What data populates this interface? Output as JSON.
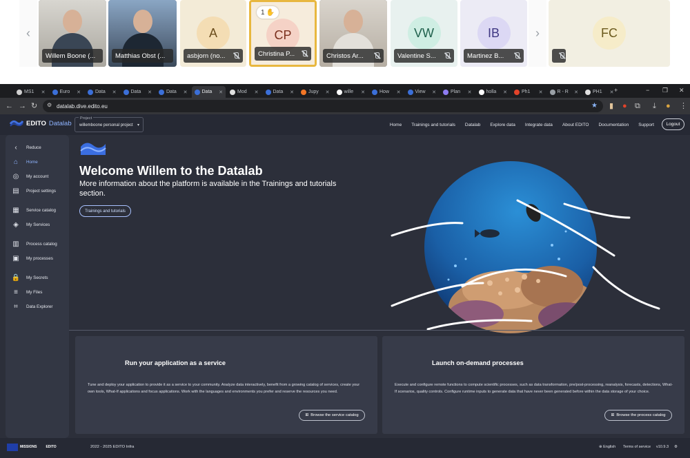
{
  "meeting": {
    "participants": [
      {
        "initials": "",
        "name": "Willem Boone (...",
        "type": "video",
        "muted": false
      },
      {
        "initials": "",
        "name": "Matthias Obst (...",
        "type": "video",
        "muted": false
      },
      {
        "initials": "A",
        "name": "asbjorn (no...",
        "type": "avatar",
        "muted": true,
        "bg": "#f3ebd7",
        "circle": "#f4ddb4",
        "fg": "#6b4d1d"
      },
      {
        "initials": "CP",
        "name": "Christina P...",
        "type": "avatar",
        "muted": true,
        "bg": "#f6ecdc",
        "circle": "#f5d2c6",
        "fg": "#7a2f1d",
        "hand": "1"
      },
      {
        "initials": "",
        "name": "Christos Ar...",
        "type": "video",
        "muted": true
      },
      {
        "initials": "VW",
        "name": "Valentine S...",
        "type": "avatar",
        "muted": true,
        "bg": "#e8f1ef",
        "circle": "#cfeee3",
        "fg": "#20614d"
      },
      {
        "initials": "IB",
        "name": "Martinez B...",
        "type": "avatar",
        "muted": true,
        "bg": "#ecebf5",
        "circle": "#dcd8f4",
        "fg": "#3f3783"
      },
      {
        "initials": "FC",
        "name": "",
        "type": "avatar",
        "muted": true,
        "bg": "#f2efe2",
        "circle": "#f6ecc9",
        "fg": "#6b5a1d"
      }
    ],
    "prev_icon": "chevron-left-icon",
    "next_icon": "chevron-right-icon"
  },
  "browser": {
    "tabs": [
      {
        "label": "MS1",
        "fav": "#d0d0d0"
      },
      {
        "label": "Euro",
        "fav": "#3b6fd8"
      },
      {
        "label": "Data",
        "fav": "#3b6fd8"
      },
      {
        "label": "Data",
        "fav": "#3b6fd8"
      },
      {
        "label": "Data",
        "fav": "#3b6fd8"
      },
      {
        "label": "Data",
        "fav": "#3b6fd8",
        "active": true
      },
      {
        "label": "Mod",
        "fav": "#e0e0e0"
      },
      {
        "label": "Data",
        "fav": "#3b6fd8"
      },
      {
        "label": "Jupy",
        "fav": "#f37626"
      },
      {
        "label": "wille",
        "fav": "#ffffff"
      },
      {
        "label": "How",
        "fav": "#3b6fd8"
      },
      {
        "label": "View",
        "fav": "#3b6fd8"
      },
      {
        "label": "Plan",
        "fav": "#8e7cf2"
      },
      {
        "label": "holla",
        "fav": "#ffffff"
      },
      {
        "label": "Ph1",
        "fav": "#e2432a"
      },
      {
        "label": "R - R",
        "fav": "#9aa0a6"
      },
      {
        "label": "PH1",
        "fav": "#e0e0e0"
      }
    ],
    "url": "datalab.dive.edito.eu",
    "window_controls": [
      "−",
      "❐",
      "✕"
    ]
  },
  "app": {
    "brand": {
      "part1": "EDITO",
      "part2": "Datalab"
    },
    "project": {
      "label": "Project",
      "value": "willemboone personal project"
    },
    "topnav": [
      "Home",
      "Trainings and tutorials",
      "Datalab",
      "Explore data",
      "Integrate data",
      "About EDITO",
      "Documentation",
      "Support"
    ],
    "logout": "Logout",
    "sidebar": [
      {
        "label": "Reduce",
        "icon": "chevron-left-icon",
        "glyph": "‹"
      },
      {
        "label": "Home",
        "icon": "home-icon",
        "glyph": "⌂",
        "active": true
      },
      {
        "label": "My account",
        "icon": "account-icon",
        "glyph": "◎"
      },
      {
        "label": "Project settings",
        "icon": "project-settings-icon",
        "glyph": "▤"
      },
      {
        "label": "Service catalog",
        "icon": "service-catalog-icon",
        "glyph": "▦"
      },
      {
        "label": "My Services",
        "icon": "layers-icon",
        "glyph": "◈"
      },
      {
        "label": "Process catalog",
        "icon": "process-catalog-icon",
        "glyph": "▥"
      },
      {
        "label": "My processes",
        "icon": "processes-icon",
        "glyph": "▣"
      },
      {
        "label": "My Secrets",
        "icon": "lock-icon",
        "glyph": "🔒"
      },
      {
        "label": "My Files",
        "icon": "files-icon",
        "glyph": "≡"
      },
      {
        "label": "Data Explorer",
        "icon": "data-explorer-icon",
        "glyph": "⌗"
      }
    ],
    "hero": {
      "title": "Welcome Willem to the Datalab",
      "subtitle": "More information about the platform is available in the Trainings and tutorials section.",
      "button": "Trainings and tutorials"
    },
    "cards": [
      {
        "title": "Run your application as a service",
        "desc": "Tune and deploy your application to provide it as a service to your community. Analyze data interactively, benefit from a growing catalog of services, create your own tools, What-If applications and focus applications. Work with the languages and environments you prefer and reserve the resources you need.",
        "button": "Browse the service catalog"
      },
      {
        "title": "Launch on-demand processes",
        "desc": "Execute and configure remote functions to compute scientific processes, such as data transformation, pre/post-processing, reanalysis, forecasts, detections, What-If scenarios, quality controls. Configure runtime inputs to generate data that have never been generated before within the data storage of your choice.",
        "button": "Browse the process catalog"
      }
    ],
    "footer": {
      "copyright": "2022 - 2025 EDITO Infra",
      "language": "English",
      "terms": "Terms of service",
      "version": "v10.9.3",
      "eu_label": "MISSIONS",
      "edito_label": "EDITO"
    }
  },
  "colors": {
    "accent": "#8fb4ff",
    "bg": "#2c2f3a",
    "card": "#373b49"
  }
}
